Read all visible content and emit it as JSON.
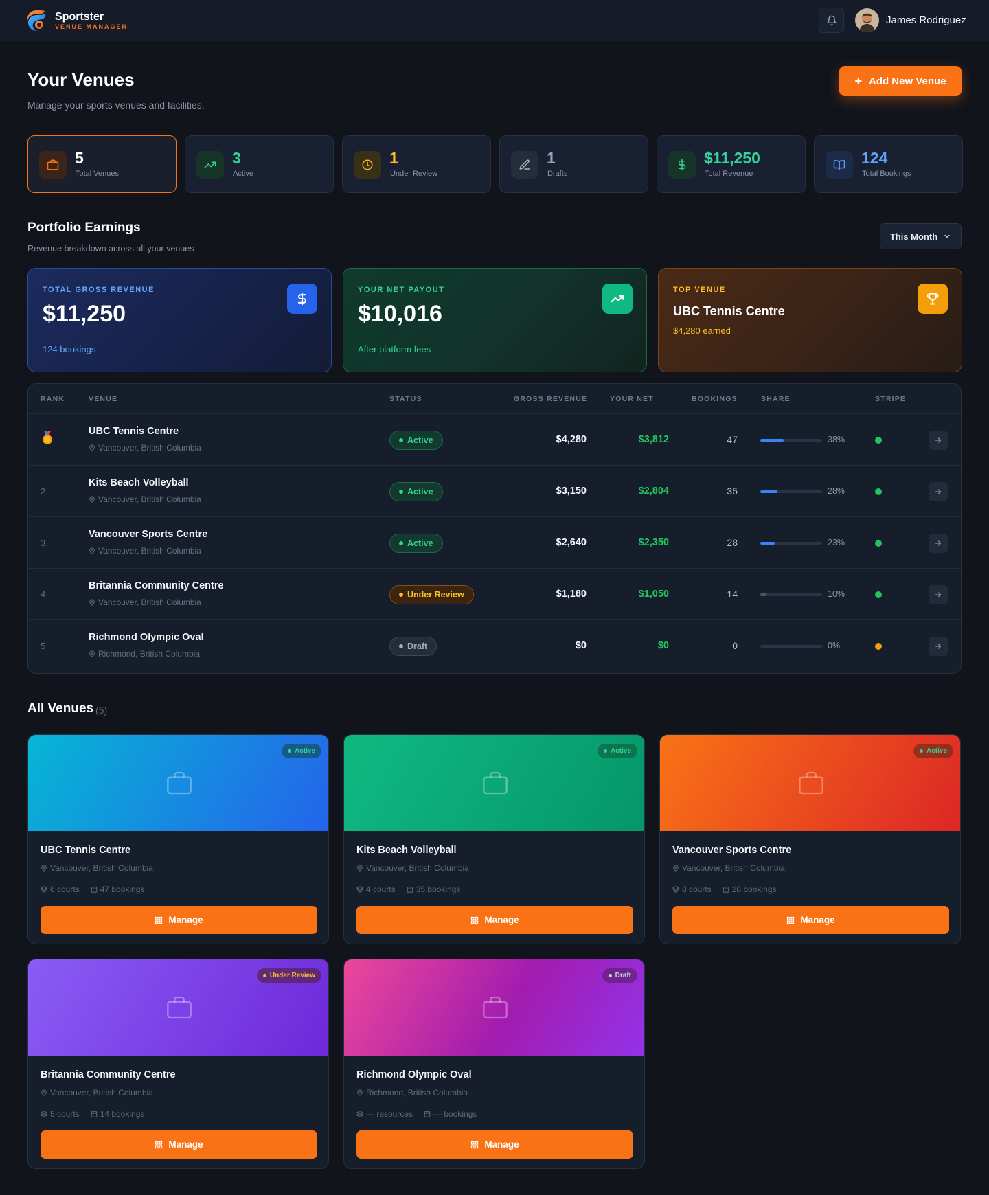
{
  "app": {
    "name": "Sportster",
    "tagline": "VENUE MANAGER"
  },
  "user": {
    "name": "James Rodriguez"
  },
  "header": {
    "title": "Your Venues",
    "subtitle": "Manage your sports venues and facilities.",
    "add_button": "Add New Venue"
  },
  "stats": [
    {
      "value": "5",
      "label": "Total Venues",
      "icon": "briefcase-icon",
      "color": "#f97316"
    },
    {
      "value": "3",
      "label": "Active",
      "icon": "trending-up-icon",
      "color": "#34d399"
    },
    {
      "value": "1",
      "label": "Under Review",
      "icon": "clock-icon",
      "color": "#fbbf24"
    },
    {
      "value": "1",
      "label": "Drafts",
      "icon": "pencil-icon",
      "color": "#94a3b8"
    },
    {
      "value": "$11,250",
      "label": "Total Revenue",
      "icon": "dollar-icon",
      "color": "#34d399"
    },
    {
      "value": "124",
      "label": "Total Bookings",
      "icon": "book-icon",
      "color": "#60a5fa"
    }
  ],
  "earnings": {
    "title": "Portfolio Earnings",
    "subtitle": "Revenue breakdown across all your venues",
    "period": "This Month",
    "gross": {
      "caption": "TOTAL GROSS REVENUE",
      "value": "$11,250",
      "foot": "124 bookings"
    },
    "net": {
      "caption": "YOUR NET PAYOUT",
      "value": "$10,016",
      "foot": "After platform fees"
    },
    "top": {
      "caption": "TOP VENUE",
      "value": "UBC Tennis Centre",
      "foot": "$4,280 earned"
    }
  },
  "table": {
    "headers": [
      "RANK",
      "VENUE",
      "STATUS",
      "GROSS REVENUE",
      "YOUR NET",
      "BOOKINGS",
      "SHARE",
      "STRIPE"
    ],
    "rows": [
      {
        "rank": "1",
        "name": "UBC Tennis Centre",
        "location": "Vancouver, British Columbia",
        "status": "Active",
        "gross": "$4,280",
        "net": "$3,812",
        "bookings": "47",
        "share": "38%",
        "share_value": 38
      },
      {
        "rank": "2",
        "name": "Kits Beach Volleyball",
        "location": "Vancouver, British Columbia",
        "status": "Active",
        "gross": "$3,150",
        "net": "$2,804",
        "bookings": "35",
        "share": "28%",
        "share_value": 28
      },
      {
        "rank": "3",
        "name": "Vancouver Sports Centre",
        "location": "Vancouver, British Columbia",
        "status": "Active",
        "gross": "$2,640",
        "net": "$2,350",
        "bookings": "28",
        "share": "23%",
        "share_value": 23
      },
      {
        "rank": "4",
        "name": "Britannia Community Centre",
        "location": "Vancouver, British Columbia",
        "status": "Under Review",
        "gross": "$1,180",
        "net": "$1,050",
        "bookings": "14",
        "share": "10%",
        "share_value": 10
      },
      {
        "rank": "5",
        "name": "Richmond Olympic Oval",
        "location": "Richmond, British Columbia",
        "status": "Draft",
        "gross": "$0",
        "net": "$0",
        "bookings": "0",
        "share": "0%",
        "share_value": 0
      }
    ]
  },
  "all_venues": {
    "title": "All Venues",
    "count": "(5)",
    "manage_label": "Manage",
    "cards": [
      {
        "name": "UBC Tennis Centre",
        "location": "Vancouver, British Columbia",
        "courts": "6 courts",
        "bookings": "47 bookings",
        "status": "Active"
      },
      {
        "name": "Kits Beach Volleyball",
        "location": "Vancouver, British Columbia",
        "courts": "4 courts",
        "bookings": "35 bookings",
        "status": "Active"
      },
      {
        "name": "Vancouver Sports Centre",
        "location": "Vancouver, British Columbia",
        "courts": "8 courts",
        "bookings": "28 bookings",
        "status": "Active"
      },
      {
        "name": "Britannia Community Centre",
        "location": "Vancouver, British Columbia",
        "courts": "5 courts",
        "bookings": "14 bookings",
        "status": "Under Review"
      },
      {
        "name": "Richmond Olympic Oval",
        "location": "Richmond, British Columbia",
        "courts": "— resources",
        "bookings": "— bookings",
        "status": "Draft"
      }
    ]
  }
}
